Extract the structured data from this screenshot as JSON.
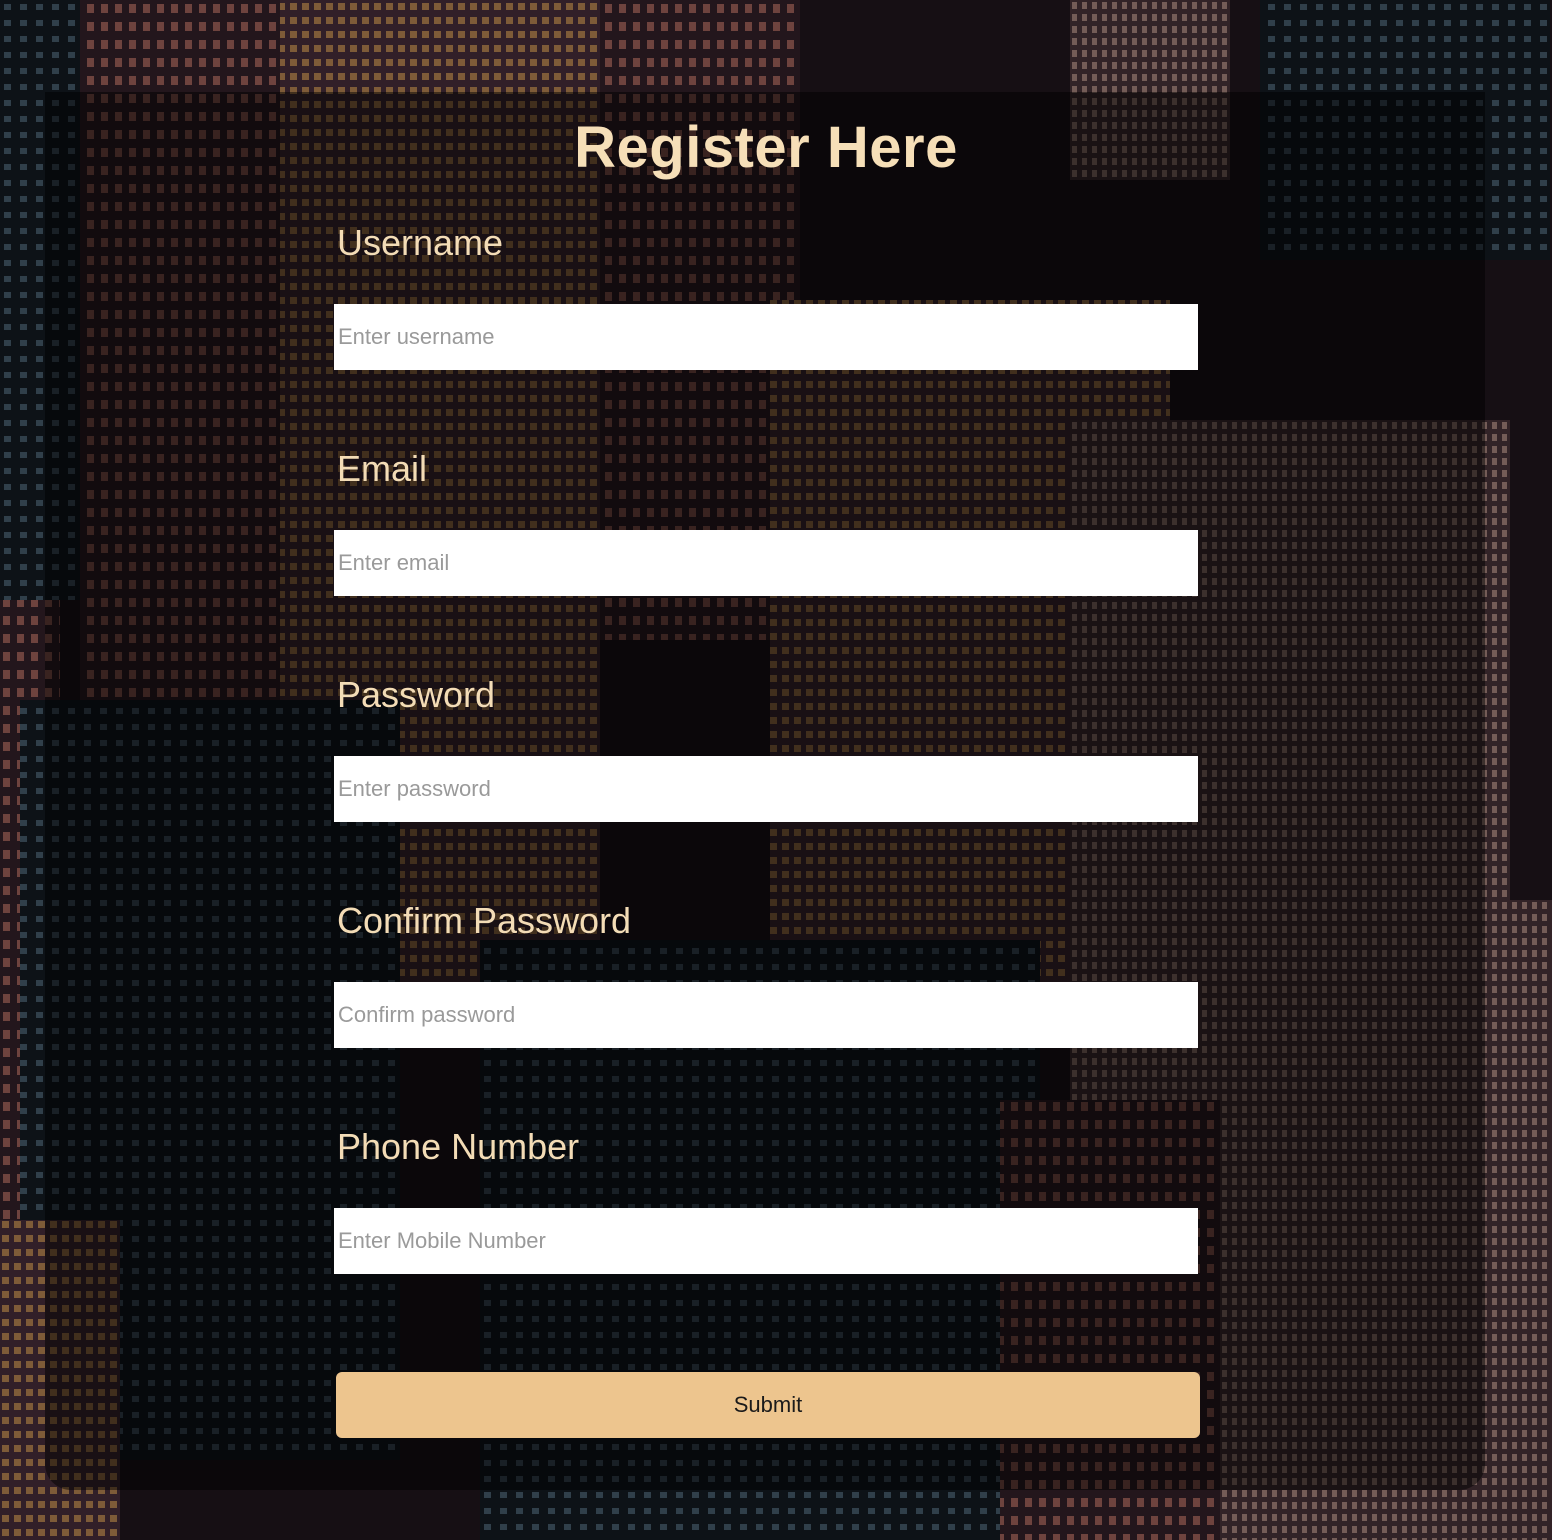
{
  "form": {
    "title": "Register Here",
    "fields": [
      {
        "label": "Username",
        "placeholder": "Enter username",
        "value": ""
      },
      {
        "label": "Email",
        "placeholder": "Enter email",
        "value": ""
      },
      {
        "label": "Password",
        "placeholder": "Enter password",
        "value": ""
      },
      {
        "label": "Confirm Password",
        "placeholder": "Confirm password",
        "value": ""
      },
      {
        "label": "Phone Number",
        "placeholder": "Enter Mobile Number",
        "value": ""
      }
    ],
    "submit_label": "Submit"
  },
  "colors": {
    "title": "#f6dfb8",
    "label": "#f3dcb6",
    "submit_bg": "#edc58e",
    "input_bg": "#ffffff"
  }
}
